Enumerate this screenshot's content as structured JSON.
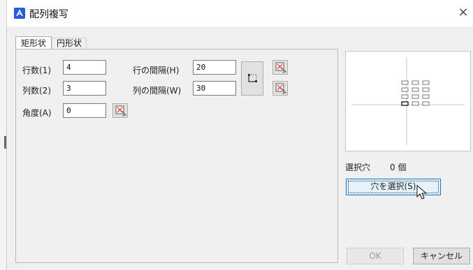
{
  "window": {
    "title": "配列複写",
    "close_label": "×"
  },
  "tabs": [
    {
      "label": "矩形状",
      "active": true
    },
    {
      "label": "円形状",
      "active": false
    }
  ],
  "fields": {
    "rows": {
      "label": "行数(1)",
      "value": "4"
    },
    "cols": {
      "label": "列数(2)",
      "value": "3"
    },
    "angle": {
      "label": "角度(A)",
      "value": "0"
    },
    "row_spacing": {
      "label": "行の間隔(H)",
      "value": "20"
    },
    "col_spacing": {
      "label": "列の間隔(W)",
      "value": "30"
    }
  },
  "selection": {
    "label": "選択穴",
    "count": "0 個"
  },
  "buttons": {
    "select_holes": "穴を選択(S)",
    "ok": "OK",
    "cancel": "キャンセル"
  },
  "colors": {
    "accent": "#0078d7",
    "title_icon": "#2a5bd7"
  },
  "icons": {
    "app": "array-app-icon",
    "pick": "pick-point-icon",
    "pick_both": "pick-spacing-icon"
  }
}
